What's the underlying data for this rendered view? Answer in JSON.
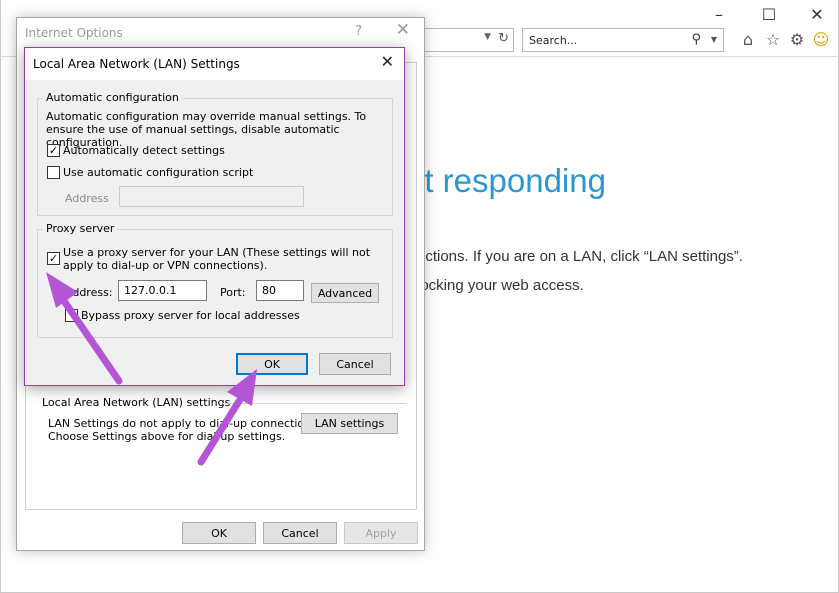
{
  "browser": {
    "search_placeholder": "Search...",
    "icons": [
      "search-icon",
      "home-icon",
      "favorites-star-icon",
      "settings-gear-icon",
      "smiley-feedback-icon"
    ],
    "page_error": {
      "heading": "’t responding",
      "line1": "ections. If you are on a LAN, click “LAN settings”.",
      "line2": "locking your web access."
    }
  },
  "internet_options": {
    "title": "Internet Options",
    "help_glyph": "?",
    "lan_group_label": "Local Area Network (LAN) settings",
    "lan_info_line1": "LAN Settings do not apply to dial-up connections.",
    "lan_info_line2": "Choose Settings above for dial-up settings.",
    "lan_settings_button": "LAN settings",
    "ok_button": "OK",
    "cancel_button": "Cancel",
    "apply_button": "Apply"
  },
  "lan_dialog": {
    "title": "Local Area Network (LAN) Settings",
    "auto_config": {
      "group_label": "Automatic configuration",
      "description": "Automatic configuration may override manual settings.  To ensure the use of manual settings, disable automatic configuration.",
      "auto_detect_label": "Automatically detect settings",
      "auto_detect_checked": true,
      "use_script_label": "Use automatic configuration script",
      "use_script_checked": false,
      "address_label": "Address",
      "address_value": ""
    },
    "proxy": {
      "group_label": "Proxy server",
      "use_proxy_label": "Use a proxy server for your LAN (These settings will not apply to dial-up or VPN connections).",
      "use_proxy_checked": true,
      "address_label": "Address:",
      "address_value": "127.0.0.1",
      "port_label": "Port:",
      "port_value": "80",
      "advanced_button": "Advanced",
      "bypass_label": "Bypass proxy server for local addresses",
      "bypass_checked": false
    },
    "ok_button": "OK",
    "cancel_button": "Cancel"
  },
  "annotations": {
    "arrow_color": "#b455d6"
  }
}
